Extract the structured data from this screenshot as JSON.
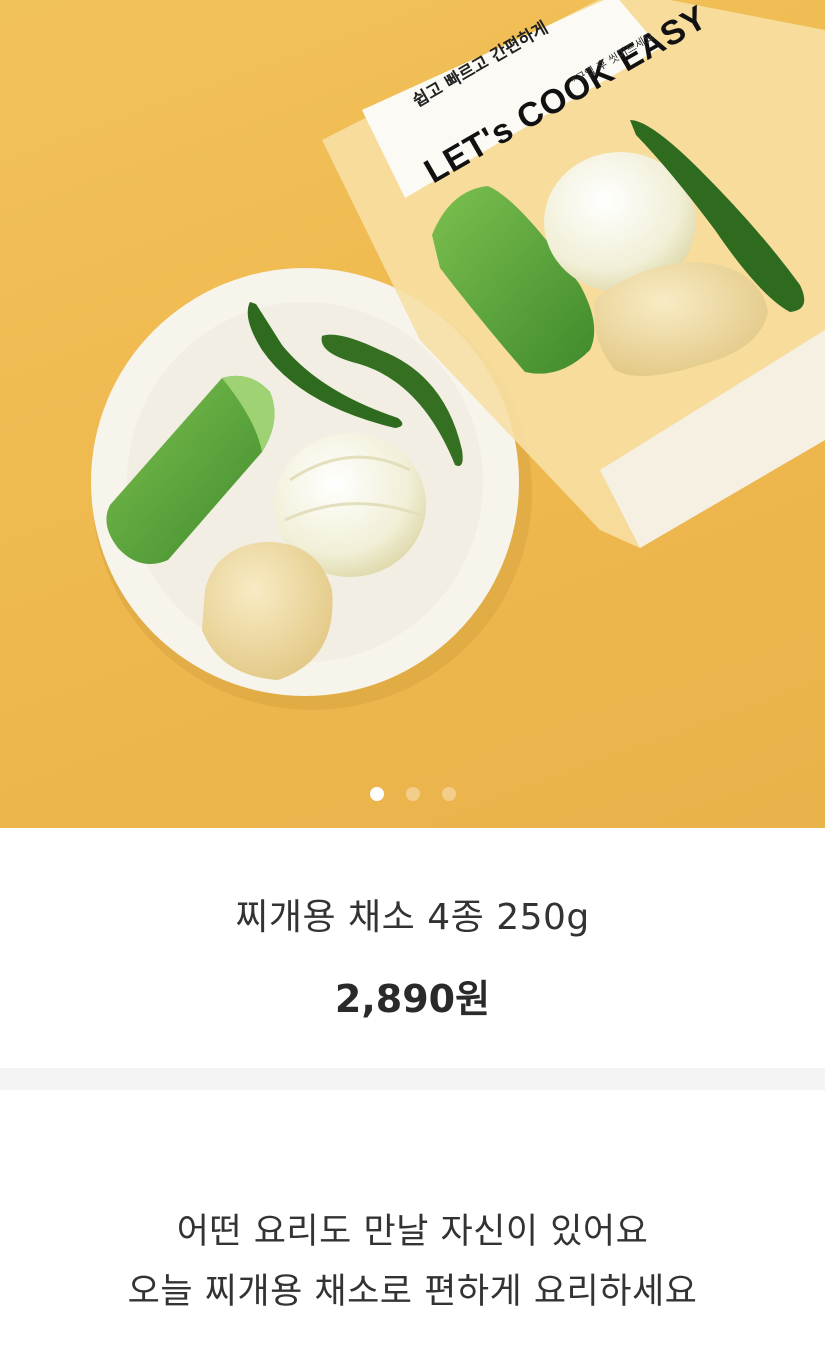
{
  "hero": {
    "image_label": "product-photo",
    "package": {
      "subtitle": "쉽고 빠르고 간편하게",
      "brand": "LET's COOK EASY",
      "note": "*구입 후 씻어드세요"
    },
    "carousel": {
      "total": 3,
      "active_index": 0
    }
  },
  "product": {
    "name": "찌개용 채소 4종 250g",
    "price": "2,890원"
  },
  "description": {
    "lines": [
      "어떤 요리도 만날 자신이 있어요",
      "오늘 찌개용 채소로 편하게 요리하세요"
    ]
  },
  "colors": {
    "background_yellow": "#efba50",
    "plate": "#f7f4ec",
    "zucchini": "#5fa03d",
    "pepper": "#2f6b1e",
    "onion": "#f3f1dc",
    "potato": "#f0dba0"
  }
}
